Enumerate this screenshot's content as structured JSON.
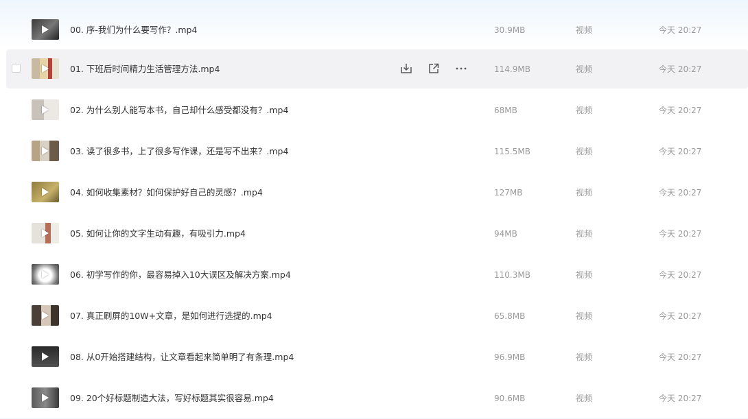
{
  "files": [
    {
      "name": "00. 序-我们为什么要写作？.mp4",
      "size": "30.9MB",
      "type": "视频",
      "modified": "今天 20:27"
    },
    {
      "name": "01. 下班后时间精力生活管理方法.mp4",
      "size": "114.9MB",
      "type": "视频",
      "modified": "今天 20:27"
    },
    {
      "name": "02. 为什么别人能写本书，自己却什么感受都没有？.mp4",
      "size": "68MB",
      "type": "视频",
      "modified": "今天 20:27"
    },
    {
      "name": "03. 读了很多书，上了很多写作课，还是写不出来？.mp4",
      "size": "115.5MB",
      "type": "视频",
      "modified": "今天 20:27"
    },
    {
      "name": "04. 如何收集素材？如何保护好自己的灵感？.mp4",
      "size": "127MB",
      "type": "视频",
      "modified": "今天 20:27"
    },
    {
      "name": "05. 如何让你的文字生动有趣，有吸引力.mp4",
      "size": "94MB",
      "type": "视频",
      "modified": "今天 20:27"
    },
    {
      "name": "06. 初学写作的你，最容易掉入10大误区及解决方案.mp4",
      "size": "110.3MB",
      "type": "视频",
      "modified": "今天 20:27"
    },
    {
      "name": "07. 真正刷屏的10W+文章，是如何进行选提的.mp4",
      "size": "65.8MB",
      "type": "视频",
      "modified": "今天 20:27"
    },
    {
      "name": "08. 从0开始搭建结构，让文章看起来简单明了有条理.mp4",
      "size": "96.9MB",
      "type": "视频",
      "modified": "今天 20:27"
    },
    {
      "name": "09. 20个好标题制造大法，写好标题其实很容易.mp4",
      "size": "90.6MB",
      "type": "视频",
      "modified": "今天 20:27"
    }
  ],
  "hovered_row_actions": [
    "download-icon",
    "share-icon",
    "more-icon"
  ],
  "colors": {
    "hover_bg": "#f2f2f4",
    "muted_text": "#999999",
    "name_text": "#333333"
  }
}
